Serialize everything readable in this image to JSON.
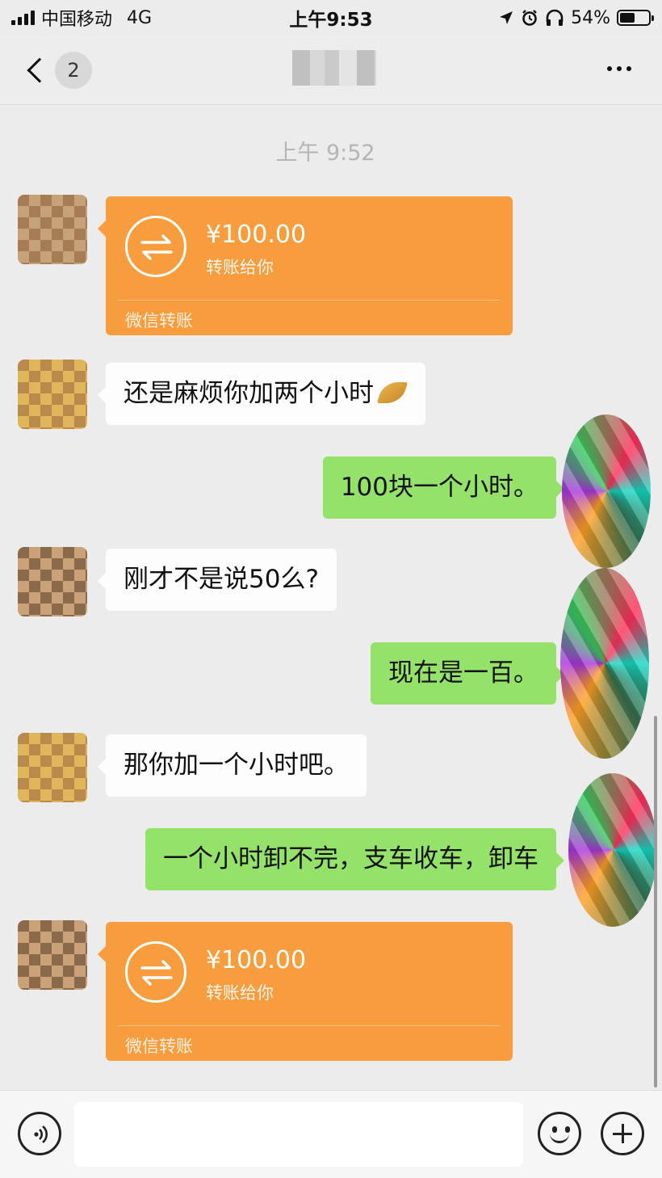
{
  "status_bar": {
    "carrier": "中国移动",
    "network": "4G",
    "time": "上午9:53",
    "battery": "54%",
    "battery_level": 0.54,
    "icons": [
      "signal-icon",
      "location-arrow-icon",
      "alarm-icon",
      "headphones-icon",
      "battery-icon"
    ]
  },
  "nav": {
    "unread_count": "2",
    "icons": [
      "back-chevron-icon",
      "more-icon"
    ]
  },
  "chat": {
    "timestamp": "上午 9:52",
    "messages": [
      {
        "side": "in",
        "kind": "transfer",
        "amount": "¥100.00",
        "note": "转账给你",
        "footer": "微信转账"
      },
      {
        "side": "in",
        "kind": "text",
        "text": "还是麻烦你加两个小时",
        "emoji": "folded-hands-icon"
      },
      {
        "side": "out",
        "kind": "text",
        "text": "100块一个小时。"
      },
      {
        "side": "in",
        "kind": "text",
        "text": "刚才不是说50么?"
      },
      {
        "side": "out",
        "kind": "text",
        "text": "现在是一百。"
      },
      {
        "side": "in",
        "kind": "text",
        "text": "那你加一个小时吧。"
      },
      {
        "side": "out",
        "kind": "text",
        "text": "一个小时卸不完，支车收车，卸车"
      },
      {
        "side": "in",
        "kind": "transfer",
        "amount": "¥100.00",
        "note": "转账给你",
        "footer": "微信转账"
      }
    ]
  },
  "input_bar": {
    "value": "",
    "icons": [
      "voice-icon",
      "emoji-icon",
      "plus-icon"
    ]
  },
  "colors": {
    "background": "#ececec",
    "outgoing_bubble": "#95e26a",
    "incoming_bubble": "#fdfdfd",
    "transfer_card": "#f79d3e",
    "timestamp": "#b5b5b5"
  }
}
